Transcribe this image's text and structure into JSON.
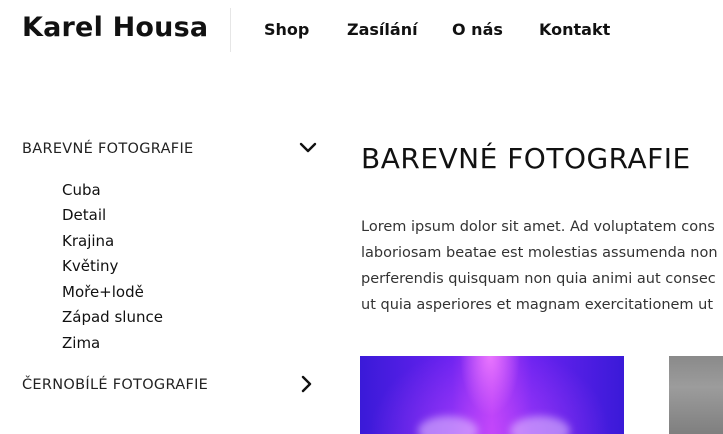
{
  "site": {
    "brand": "Karel Housa"
  },
  "nav": {
    "items": [
      "Shop",
      "Zasílání",
      "O nás",
      "Kontakt"
    ]
  },
  "sidebar": {
    "categories": [
      {
        "label": "BAREVNÉ FOTOGRAFIE",
        "icon": "chevron-down-icon",
        "expanded": true,
        "items": [
          "Cuba",
          "Detail",
          "Krajina",
          "Květiny",
          "Moře+lodě",
          "Západ slunce",
          "Zima"
        ]
      },
      {
        "label": "ČERNOBÍLÉ FOTOGRAFIE",
        "icon": "chevron-right-icon",
        "expanded": false,
        "items": []
      }
    ]
  },
  "main": {
    "title": "BAREVNÉ FOTOGRAFIE",
    "paragraph_lines": [
      "Lorem ipsum dolor sit amet. Ad voluptatem cons",
      "laboriosam beatae est molestias assumenda non",
      "perferendis quisquam non quia animi aut consec",
      "ut quia asperiores et magnam exercitationem ut"
    ]
  }
}
